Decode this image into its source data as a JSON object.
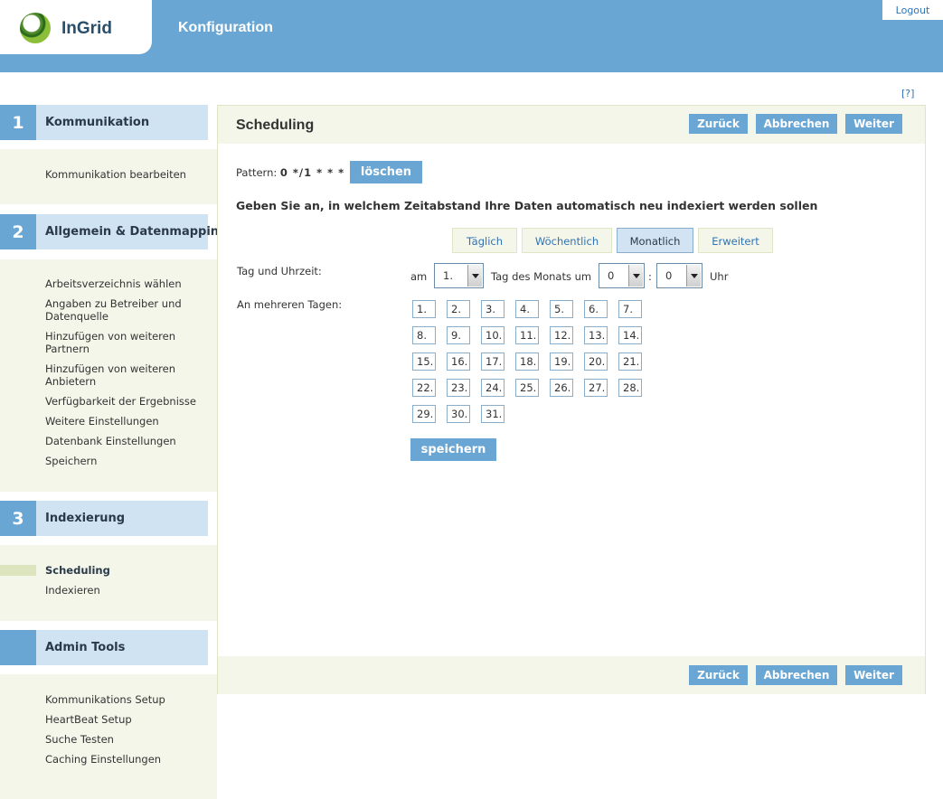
{
  "header": {
    "logo_text": "InGrid",
    "title": "Konfiguration",
    "logout_label": "Logout"
  },
  "help_label": "[?]",
  "sidebar": {
    "sections": [
      {
        "number": "1",
        "title": "Kommunikation",
        "items": [
          "Kommunikation bearbeiten"
        ]
      },
      {
        "number": "2",
        "title": "Allgemein & Datenmapping",
        "items": [
          "Arbeitsverzeichnis wählen",
          "Angaben zu Betreiber und Datenquelle",
          "Hinzufügen von weiteren Partnern",
          "Hinzufügen von weiteren Anbietern",
          "Verfügbarkeit der Ergebnisse",
          "Weitere Einstellungen",
          "Datenbank Einstellungen",
          "Speichern"
        ]
      },
      {
        "number": "3",
        "title": "Indexierung",
        "items": [
          "Scheduling",
          "Indexieren"
        ],
        "active_item": "Scheduling"
      },
      {
        "number": "",
        "title": "Admin Tools",
        "items": [
          "Kommunikations Setup",
          "HeartBeat Setup",
          "Suche Testen",
          "Caching Einstellungen"
        ]
      }
    ]
  },
  "panel": {
    "title": "Scheduling",
    "buttons": {
      "back": "Zurück",
      "cancel": "Abbrechen",
      "next": "Weiter"
    },
    "pattern_label": "Pattern:",
    "pattern_value": "0 */1 * * *",
    "delete_label": "löschen",
    "instruction": "Geben Sie an, in welchem Zeitabstand Ihre Daten automatisch neu indexiert werden sollen",
    "tabs": [
      "Täglich",
      "Wöchentlich",
      "Monatlich",
      "Erweitert"
    ],
    "active_tab": "Monatlich",
    "time_row": {
      "label": "Tag und Uhrzeit:",
      "am": "am",
      "day_value": "1.",
      "middle_text": "Tag des Monats um",
      "hour_value": "0",
      "colon": ":",
      "minute_value": "0",
      "uhr": "Uhr"
    },
    "multi_days_label": "An mehreren Tagen:",
    "days": [
      "1.",
      "2.",
      "3.",
      "4.",
      "5.",
      "6.",
      "7.",
      "8.",
      "9.",
      "10.",
      "11.",
      "12.",
      "13.",
      "14.",
      "15.",
      "16.",
      "17.",
      "18.",
      "19.",
      "20.",
      "21.",
      "22.",
      "23.",
      "24.",
      "25.",
      "26.",
      "27.",
      "28.",
      "29.",
      "30.",
      "31."
    ],
    "save_label": "speichern"
  }
}
